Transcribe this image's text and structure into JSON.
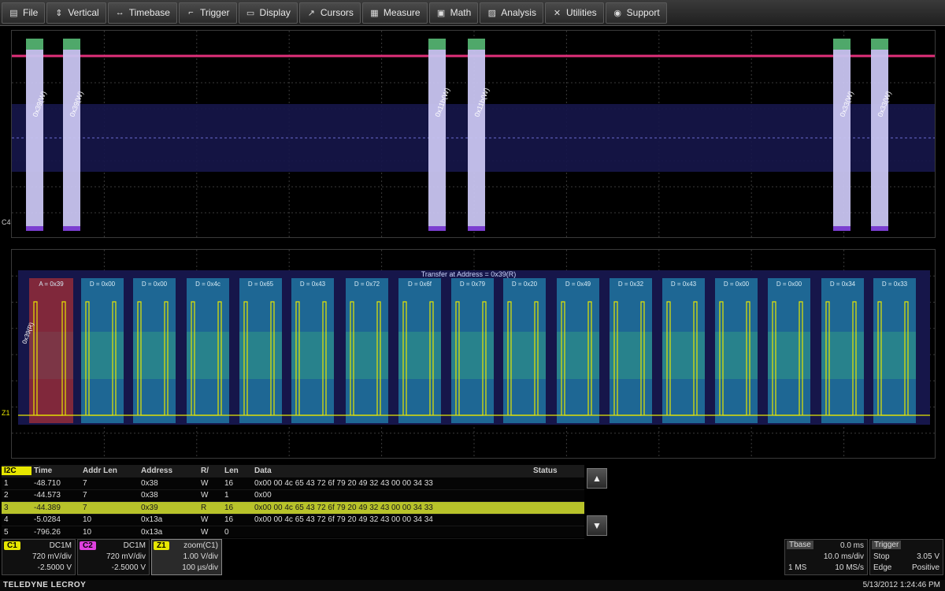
{
  "menubar": {
    "items": [
      {
        "label": "File",
        "icon": "file-icon"
      },
      {
        "label": "Vertical",
        "icon": "vertical-icon"
      },
      {
        "label": "Timebase",
        "icon": "timebase-icon"
      },
      {
        "label": "Trigger",
        "icon": "trigger-icon"
      },
      {
        "label": "Display",
        "icon": "display-icon"
      },
      {
        "label": "Cursors",
        "icon": "cursor-icon"
      },
      {
        "label": "Measure",
        "icon": "measure-icon"
      },
      {
        "label": "Math",
        "icon": "math-icon"
      },
      {
        "label": "Analysis",
        "icon": "analysis-icon"
      },
      {
        "label": "Utilities",
        "icon": "utilities-icon"
      },
      {
        "label": "Support",
        "icon": "support-icon"
      }
    ]
  },
  "top_grid": {
    "bursts": [
      "0x39(W)",
      "0x39(W)",
      "0x11b(W)",
      "0x11b(W)",
      "0x33(W)",
      "0x33(W)"
    ],
    "channel_marker": "C4"
  },
  "zoom_grid": {
    "title": "Transfer at Address = 0x39(R)",
    "address_label": "0x39(R)",
    "channel_marker": "Z1",
    "cells": [
      "A = 0x39",
      "D = 0x00",
      "D = 0x00",
      "D = 0x4c",
      "D = 0x65",
      "D = 0x43",
      "D = 0x72",
      "D = 0x6f",
      "D = 0x79",
      "D = 0x20",
      "D = 0x49",
      "D = 0x32",
      "D = 0x43",
      "D = 0x00",
      "D = 0x00",
      "D = 0x34",
      "D = 0x33"
    ]
  },
  "table": {
    "tag": "I2C",
    "columns": [
      "Time",
      "Addr Len",
      "Address",
      "R/",
      "Len",
      "Data",
      "Status"
    ],
    "rows": [
      {
        "idx": "1",
        "time": "-48.710",
        "addrlen": "7",
        "address": "0x38",
        "rw": "W",
        "len": "16",
        "data": "0x00 00 4c 65 43 72 6f 79 20 49 32 43 00 00 34 33",
        "status": ""
      },
      {
        "idx": "2",
        "time": "-44.573",
        "addrlen": "7",
        "address": "0x38",
        "rw": "W",
        "len": "1",
        "data": "0x00",
        "status": ""
      },
      {
        "idx": "3",
        "time": "-44.389",
        "addrlen": "7",
        "address": "0x39",
        "rw": "R",
        "len": "16",
        "data": "0x00 00 4c 65 43 72 6f 79 20 49 32 43 00 00 34 33",
        "status": ""
      },
      {
        "idx": "4",
        "time": "-5.0284",
        "addrlen": "10",
        "address": "0x13a",
        "rw": "W",
        "len": "16",
        "data": "0x00 00 4c 65 43 72 6f 79 20 49 32 43 00 00 34 34",
        "status": ""
      },
      {
        "idx": "5",
        "time": "-796.26",
        "addrlen": "10",
        "address": "0x13a",
        "rw": "W",
        "len": "0",
        "data": "",
        "status": ""
      }
    ],
    "selected_row": 2
  },
  "channels": [
    {
      "tag": "C1",
      "coupling": "DC1M",
      "vdiv": "720 mV/div",
      "offset": "-2.5000 V",
      "color": "#e6e600"
    },
    {
      "tag": "C2",
      "coupling": "DC1M",
      "vdiv": "720 mV/div",
      "offset": "-2.5000 V",
      "color": "#e040e0"
    }
  ],
  "zoom_info": {
    "tag": "Z1",
    "name": "zoom(C1)",
    "vdiv": "1.00 V/div",
    "tdiv": "100 µs/div"
  },
  "timebase": {
    "label": "Tbase",
    "delay": "0.0 ms",
    "tdiv": "10.0 ms/div",
    "points": "1 MS",
    "rate": "10 MS/s"
  },
  "trigger": {
    "label": "Trigger",
    "mode": "Stop",
    "level": "3.05 V",
    "type": "Edge",
    "slope": "Positive"
  },
  "brand": "TELEDYNE LECROY",
  "datetime": "5/13/2012 1:24:46 PM",
  "colors": {
    "ch1": "#e6e600",
    "ch2": "#e040e0",
    "decode": "#1f6f9a",
    "selected": "#b8c32a"
  }
}
